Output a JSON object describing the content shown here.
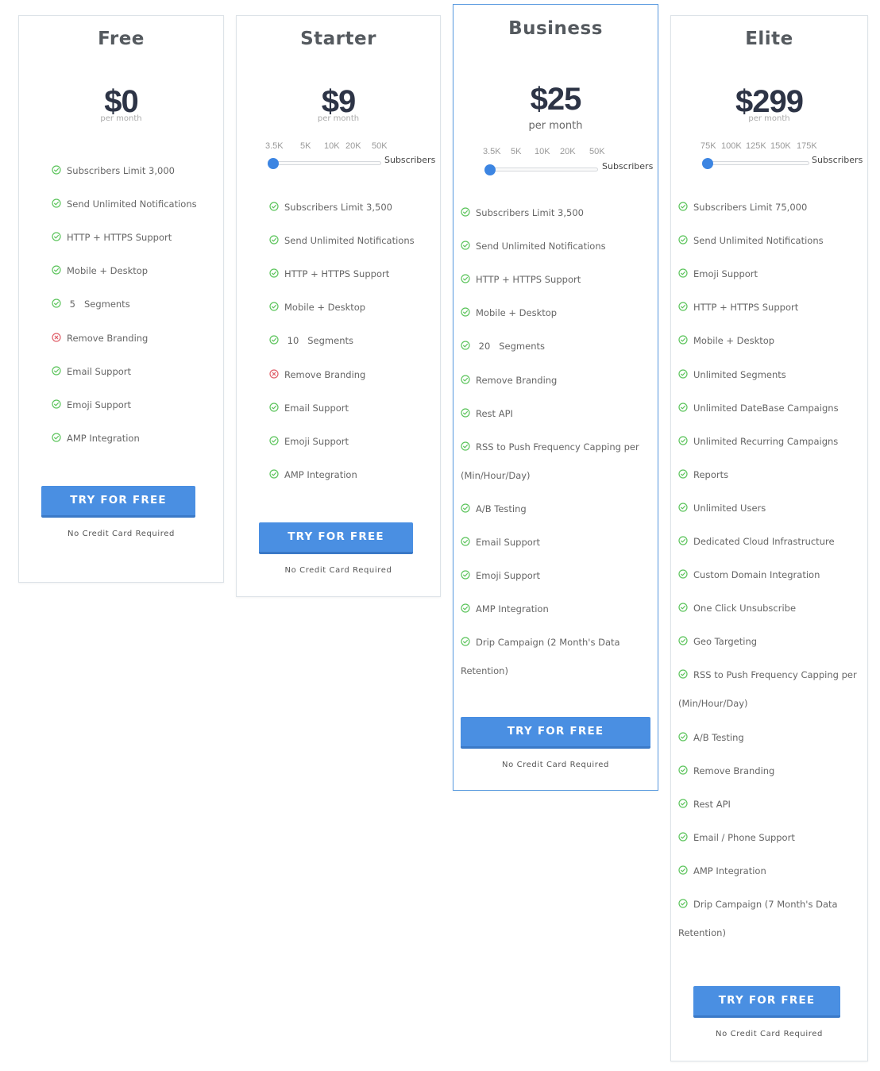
{
  "colors": {
    "accent": "#4a8fe2",
    "check": "#5cc45c",
    "cross": "#e0606a",
    "price": "#2d3446",
    "featured_border": "#5a9be0"
  },
  "plans": [
    {
      "id": "free",
      "name": "Free",
      "price": "$0",
      "period": "per month",
      "slider": null,
      "features": [
        {
          "text": "Subscribers Limit 3,000",
          "included": true
        },
        {
          "text": "Send Unlimited Notifications",
          "included": true
        },
        {
          "text": "HTTP + HTTPS Support",
          "included": true
        },
        {
          "text": "Mobile + Desktop",
          "included": true
        },
        {
          "text": " 5   Segments",
          "included": true
        },
        {
          "text": "Remove Branding",
          "included": false
        },
        {
          "text": "Email Support",
          "included": true
        },
        {
          "text": "Emoji Support",
          "included": true
        },
        {
          "text": "AMP Integration",
          "included": true
        }
      ],
      "cta": "TRY FOR FREE",
      "note": "No Credit Card Required"
    },
    {
      "id": "starter",
      "name": "Starter",
      "price": "$9",
      "period": "per month",
      "slider": {
        "labels": [
          "3.5K",
          "5K",
          "10K",
          "20K",
          "50K"
        ],
        "caption": "Subscribers",
        "selected": "3.5K",
        "value_fraction": 0
      },
      "features": [
        {
          "text": "Subscribers Limit 3,500",
          "included": true
        },
        {
          "text": "Send Unlimited Notifications",
          "included": true
        },
        {
          "text": "HTTP + HTTPS Support",
          "included": true
        },
        {
          "text": "Mobile + Desktop",
          "included": true
        },
        {
          "text": " 10   Segments",
          "included": true
        },
        {
          "text": "Remove Branding",
          "included": false
        },
        {
          "text": "Email Support",
          "included": true
        },
        {
          "text": "Emoji Support",
          "included": true
        },
        {
          "text": "AMP Integration",
          "included": true
        }
      ],
      "cta": "TRY FOR FREE",
      "note": "No Credit Card Required"
    },
    {
      "id": "business",
      "name": "Business",
      "price": "$25",
      "period": "per month",
      "featured": true,
      "slider": {
        "labels": [
          "3.5K",
          "5K",
          "10K",
          "20K",
          "50K"
        ],
        "caption": "Subscribers",
        "selected": "3.5K",
        "value_fraction": 0
      },
      "features": [
        {
          "text": "Subscribers Limit 3,500",
          "included": true
        },
        {
          "text": "Send Unlimited Notifications",
          "included": true
        },
        {
          "text": "HTTP + HTTPS Support",
          "included": true
        },
        {
          "text": "Mobile + Desktop",
          "included": true
        },
        {
          "text": " 20   Segments",
          "included": true
        },
        {
          "text": "Remove Branding",
          "included": true
        },
        {
          "text": "Rest API",
          "included": true
        },
        {
          "text": "RSS to Push Frequency Capping per",
          "wrap": "(Min/Hour/Day)",
          "included": true
        },
        {
          "text": "A/B Testing",
          "included": true
        },
        {
          "text": "Email Support",
          "included": true
        },
        {
          "text": "Emoji Support",
          "included": true
        },
        {
          "text": "AMP Integration",
          "included": true
        },
        {
          "text": "Drip Campaign (2 Month's Data",
          "wrap": "Retention)",
          "included": true
        }
      ],
      "cta": "TRY FOR FREE",
      "note": "No Credit Card Required"
    },
    {
      "id": "elite",
      "name": "Elite",
      "price": "$299",
      "period": "per month",
      "slider": {
        "labels": [
          "75K",
          "100K",
          "125K",
          "150K",
          "175K"
        ],
        "caption": "Subscribers",
        "selected": "75K",
        "value_fraction": 0
      },
      "features": [
        {
          "text": "Subscribers Limit 75,000",
          "included": true
        },
        {
          "text": "Send Unlimited Notifications",
          "included": true
        },
        {
          "text": "Emoji Support",
          "included": true
        },
        {
          "text": "HTTP + HTTPS Support",
          "included": true
        },
        {
          "text": "Mobile + Desktop",
          "included": true
        },
        {
          "text": "Unlimited Segments",
          "included": true
        },
        {
          "text": "Unlimited DateBase Campaigns",
          "included": true
        },
        {
          "text": "Unlimited Recurring Campaigns",
          "included": true
        },
        {
          "text": "Reports",
          "included": true
        },
        {
          "text": "Unlimited Users",
          "included": true
        },
        {
          "text": "Dedicated Cloud Infrastructure",
          "included": true
        },
        {
          "text": "Custom Domain Integration",
          "included": true
        },
        {
          "text": "One Click Unsubscribe",
          "included": true
        },
        {
          "text": "Geo Targeting",
          "included": true
        },
        {
          "text": "RSS to Push Frequency Capping per",
          "wrap": "(Min/Hour/Day)",
          "included": true
        },
        {
          "text": "A/B Testing",
          "included": true
        },
        {
          "text": "Remove Branding",
          "included": true
        },
        {
          "text": "Rest API",
          "included": true
        },
        {
          "text": "Email / Phone Support",
          "included": true
        },
        {
          "text": "AMP Integration",
          "included": true
        },
        {
          "text": "Drip Campaign (7 Month's Data",
          "wrap": "Retention)",
          "included": true
        }
      ],
      "cta": "TRY FOR FREE",
      "note": "No Credit Card Required"
    }
  ]
}
